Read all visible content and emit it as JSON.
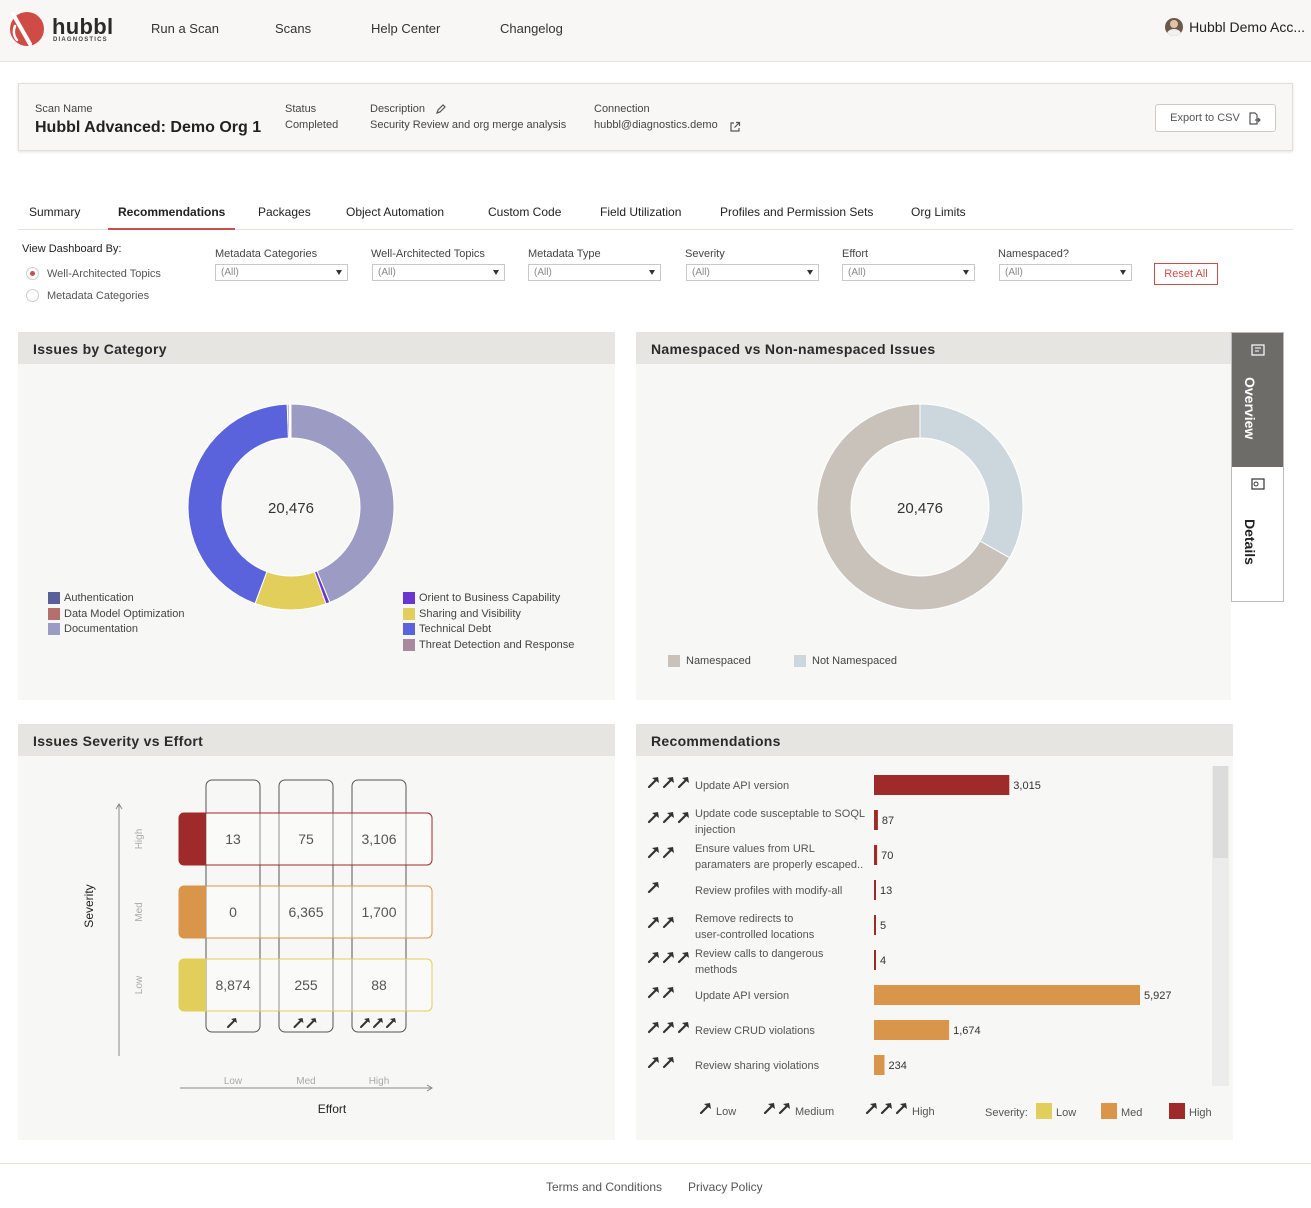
{
  "brand": {
    "name": "hubbl",
    "sub": "DIAGNOSTICS"
  },
  "nav": {
    "links": [
      "Run a Scan",
      "Scans",
      "Help Center",
      "Changelog"
    ],
    "account": "Hubbl Demo Acc..."
  },
  "scan": {
    "name_label": "Scan Name",
    "name": "Hubbl Advanced: Demo Org 1",
    "status_label": "Status",
    "status": "Completed",
    "description_label": "Description",
    "description": "Security Review and org merge analysis",
    "connection_label": "Connection",
    "connection": "hubbl@diagnostics.demo",
    "export_label": "Export to CSV"
  },
  "tabs": [
    "Summary",
    "Recommendations",
    "Packages",
    "Object Automation",
    "Custom Code",
    "Field Utilization",
    "Profiles and Permission Sets",
    "Org Limits"
  ],
  "active_tab": "Recommendations",
  "view_by": {
    "label": "View Dashboard By:",
    "options": [
      "Well-Architected Topics",
      "Metadata Categories"
    ],
    "selected": "Well-Architected Topics"
  },
  "filters": [
    {
      "label": "Metadata Categories",
      "value": "(All)"
    },
    {
      "label": "Well-Architected Topics",
      "value": "(All)"
    },
    {
      "label": "Metadata Type",
      "value": "(All)"
    },
    {
      "label": "Severity",
      "value": "(All)"
    },
    {
      "label": "Effort",
      "value": "(All)"
    },
    {
      "label": "Namespaced?",
      "value": "(All)"
    }
  ],
  "reset_label": "Reset All",
  "side_tabs": {
    "overview": "Overview",
    "details": "Details"
  },
  "issues_by_category": {
    "title": "Issues by Category",
    "total": "20,476",
    "legend_left": [
      {
        "name": "Authentication",
        "color": "#57609a"
      },
      {
        "name": "Data Model Optimization",
        "color": "#b56f6f"
      },
      {
        "name": "Documentation",
        "color": "#9b9bc4"
      }
    ],
    "legend_right": [
      {
        "name": "Orient to Business Capability",
        "color": "#6a35d0"
      },
      {
        "name": "Sharing and Visibility",
        "color": "#e2cf5b"
      },
      {
        "name": "Technical Debt",
        "color": "#5a63dc"
      },
      {
        "name": "Threat Detection and Response",
        "color": "#a88a9e"
      }
    ],
    "chart_data": {
      "type": "pie",
      "center_label": "20,476",
      "slices": [
        {
          "name": "Documentation",
          "value": 8980,
          "color": "#9b9bc4"
        },
        {
          "name": "Orient to Business Capability",
          "value": 130,
          "color": "#6a35d0"
        },
        {
          "name": "Sharing and Visibility",
          "value": 2290,
          "color": "#e2cf5b"
        },
        {
          "name": "Technical Debt",
          "value": 8956,
          "color": "#5a63dc"
        },
        {
          "name": "Threat Detection and Response",
          "value": 60,
          "color": "#a88a9e"
        },
        {
          "name": "Data Model Optimization",
          "value": 30,
          "color": "#b56f6f"
        },
        {
          "name": "Authentication",
          "value": 30,
          "color": "#57609a"
        }
      ]
    }
  },
  "namespaced": {
    "title": "Namespaced vs Non-namespaced Issues",
    "total": "20,476",
    "legend": [
      {
        "name": "Namespaced",
        "color": "#c8c2ba"
      },
      {
        "name": "Not Namespaced",
        "color": "#ccd6dd"
      }
    ],
    "chart_data": {
      "type": "pie",
      "center_label": "20,476",
      "slices": [
        {
          "name": "Not Namespaced",
          "value": 6800,
          "color": "#ccd6dd"
        },
        {
          "name": "Namespaced",
          "value": 13676,
          "color": "#c8c2ba"
        }
      ]
    }
  },
  "severity_effort": {
    "title": "Issues Severity vs Effort",
    "y_title": "Severity",
    "x_title": "Effort",
    "rows": [
      "High",
      "Med",
      "Low"
    ],
    "cols": [
      "Low",
      "Med",
      "High"
    ],
    "row_colors": [
      "#9e2a2a",
      "#d9964a",
      "#e2cf5b"
    ],
    "chart_data": {
      "type": "heatmap",
      "rows": [
        "High",
        "Med",
        "Low"
      ],
      "cols": [
        "Low",
        "Med",
        "High"
      ],
      "values": [
        [
          "13",
          "75",
          "3,106"
        ],
        [
          "0",
          "6,365",
          "1,700"
        ],
        [
          "8,874",
          "255",
          "88"
        ]
      ]
    }
  },
  "recommendations": {
    "title": "Recommendations",
    "chart_data": {
      "type": "bar",
      "categories": [
        "Update API version",
        "Update code susceptable to SOQL injection",
        "Ensure values from URL paramaters are properly escaped..",
        "Review profiles with modify-all",
        "Remove redirects to user-controlled locations",
        "Review calls to dangerous methods",
        "Update API version",
        "Review CRUD violations",
        "Review sharing violations"
      ],
      "values": [
        3015,
        87,
        70,
        13,
        5,
        4,
        5927,
        1674,
        234
      ],
      "labels": [
        "3,015",
        "87",
        "70",
        "13",
        "5",
        "4",
        "5,927",
        "1,674",
        "234"
      ],
      "effort": [
        3,
        3,
        2,
        1,
        2,
        3,
        2,
        3,
        2
      ],
      "severity": [
        "High",
        "High",
        "High",
        "High",
        "High",
        "High",
        "Med",
        "Med",
        "Med"
      ],
      "xlim": [
        0,
        5927
      ]
    },
    "label_lines": [
      [
        "Update API version"
      ],
      [
        "Update code susceptable to SOQL",
        "injection"
      ],
      [
        "Ensure values from URL",
        "paramaters are properly escaped.."
      ],
      [
        "Review profiles with modify-all"
      ],
      [
        "Remove redirects to",
        "user-controlled locations"
      ],
      [
        "Review calls to dangerous",
        "methods"
      ],
      [
        "Update API version"
      ],
      [
        "Review CRUD violations"
      ],
      [
        "Review sharing violations"
      ]
    ],
    "severity_colors": {
      "Low": "#e2cf5b",
      "Med": "#d9964a",
      "High": "#9e2a2a"
    },
    "legend_effort": [
      "Low",
      "Medium",
      "High"
    ],
    "legend_severity_label": "Severity:",
    "legend_severity": [
      {
        "name": "Low",
        "color": "#e2cf5b"
      },
      {
        "name": "Med",
        "color": "#d9964a"
      },
      {
        "name": "High",
        "color": "#9e2a2a"
      }
    ]
  },
  "footer": {
    "links": [
      "Terms and Conditions",
      "Privacy Policy"
    ]
  }
}
